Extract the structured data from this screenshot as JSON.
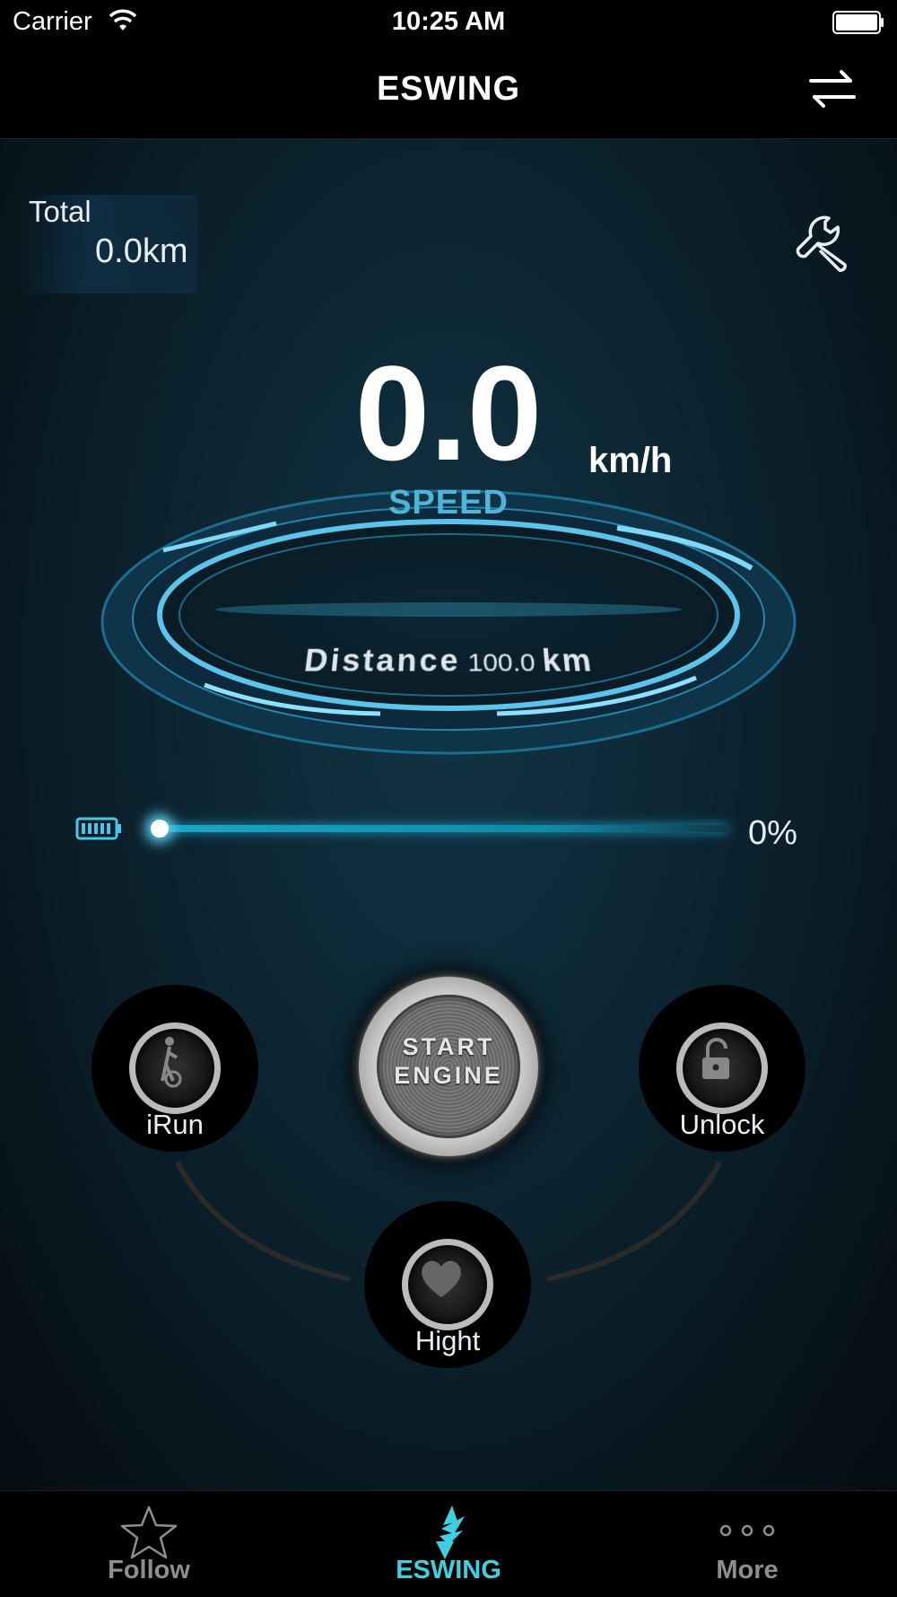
{
  "status_bar": {
    "carrier": "Carrier",
    "time": "10:25 AM"
  },
  "nav": {
    "title": "ESWING",
    "right_icon": "swap-icon"
  },
  "trip": {
    "total_label": "Total",
    "total_value": "0.0km"
  },
  "speed": {
    "value": "0.0",
    "unit": "km/h",
    "label": "SPEED"
  },
  "distance": {
    "label": "Distance",
    "value": "100.0",
    "unit": "km"
  },
  "battery": {
    "percent_label": "0%",
    "level": 0
  },
  "controls": {
    "irun": "iRun",
    "start_line1": "START",
    "start_line2": "ENGINE",
    "unlock": "Unlock",
    "hight": "Hight"
  },
  "tabs": [
    {
      "label": "Follow",
      "icon": "star-icon",
      "active": false
    },
    {
      "label": "ESWING",
      "icon": "eswing-logo-icon",
      "active": true
    },
    {
      "label": "More",
      "icon": "more-dots-icon",
      "active": false
    }
  ],
  "colors": {
    "accent": "#3fd0e0",
    "speed_label": "#4fb4d6",
    "inactive_tab": "#8e8e8e",
    "background": "#0c2430"
  }
}
